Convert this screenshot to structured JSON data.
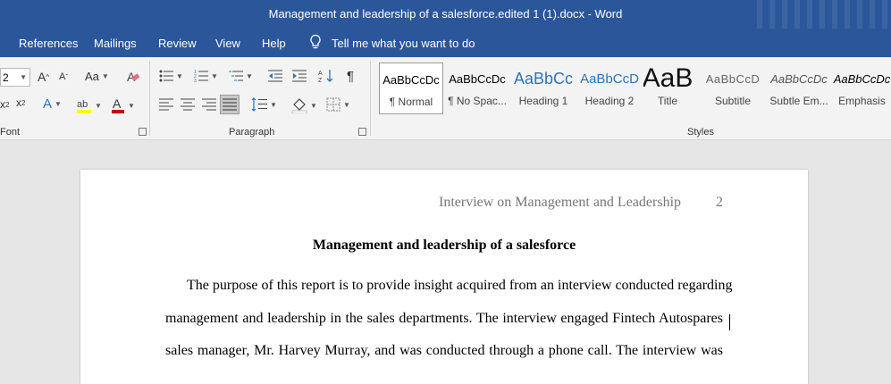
{
  "window": {
    "title": "Management and leadership of a salesforce.edited 1 (1).docx  -  Word"
  },
  "ribbon_tabs": [
    "References",
    "Mailings",
    "Review",
    "View",
    "Help"
  ],
  "tell_me": {
    "text": "Tell me what you want to do",
    "icon": "lightbulb-icon"
  },
  "font_group": {
    "label": "Font",
    "font_size": "2"
  },
  "paragraph_group": {
    "label": "Paragraph"
  },
  "styles_group": {
    "label": "Styles",
    "items": [
      {
        "sample": "AaBbCcDc",
        "name": "¶ Normal",
        "selected": true
      },
      {
        "sample": "AaBbCcDc",
        "name": "¶ No Spac..."
      },
      {
        "sample": "AaBbCc",
        "name": "Heading 1"
      },
      {
        "sample": "AaBbCcD",
        "name": "Heading 2"
      },
      {
        "sample": "AaB",
        "name": "Title"
      },
      {
        "sample": "AaBbCcD",
        "name": "Subtitle"
      },
      {
        "sample": "AaBbCcDc",
        "name": "Subtle Em..."
      },
      {
        "sample": "AaBbCcDc",
        "name": "Emphasis"
      }
    ]
  },
  "colors": {
    "title_bar": "#2b579a",
    "heading_style": "#2e74b5",
    "highlight": "#ffff00",
    "font_color": "#c00000"
  },
  "document": {
    "header_text": "Interview on Management and Leadership",
    "page_number": "2",
    "title": "Management and leadership of a salesforce",
    "lines": [
      "The purpose of this report is to provide insight acquired from an interview conducted regarding",
      "management and leadership in the sales departments. The interview engaged Fintech Autospares",
      "sales manager, Mr. Harvey Murray, and was conducted through a phone call. The interview was"
    ]
  }
}
